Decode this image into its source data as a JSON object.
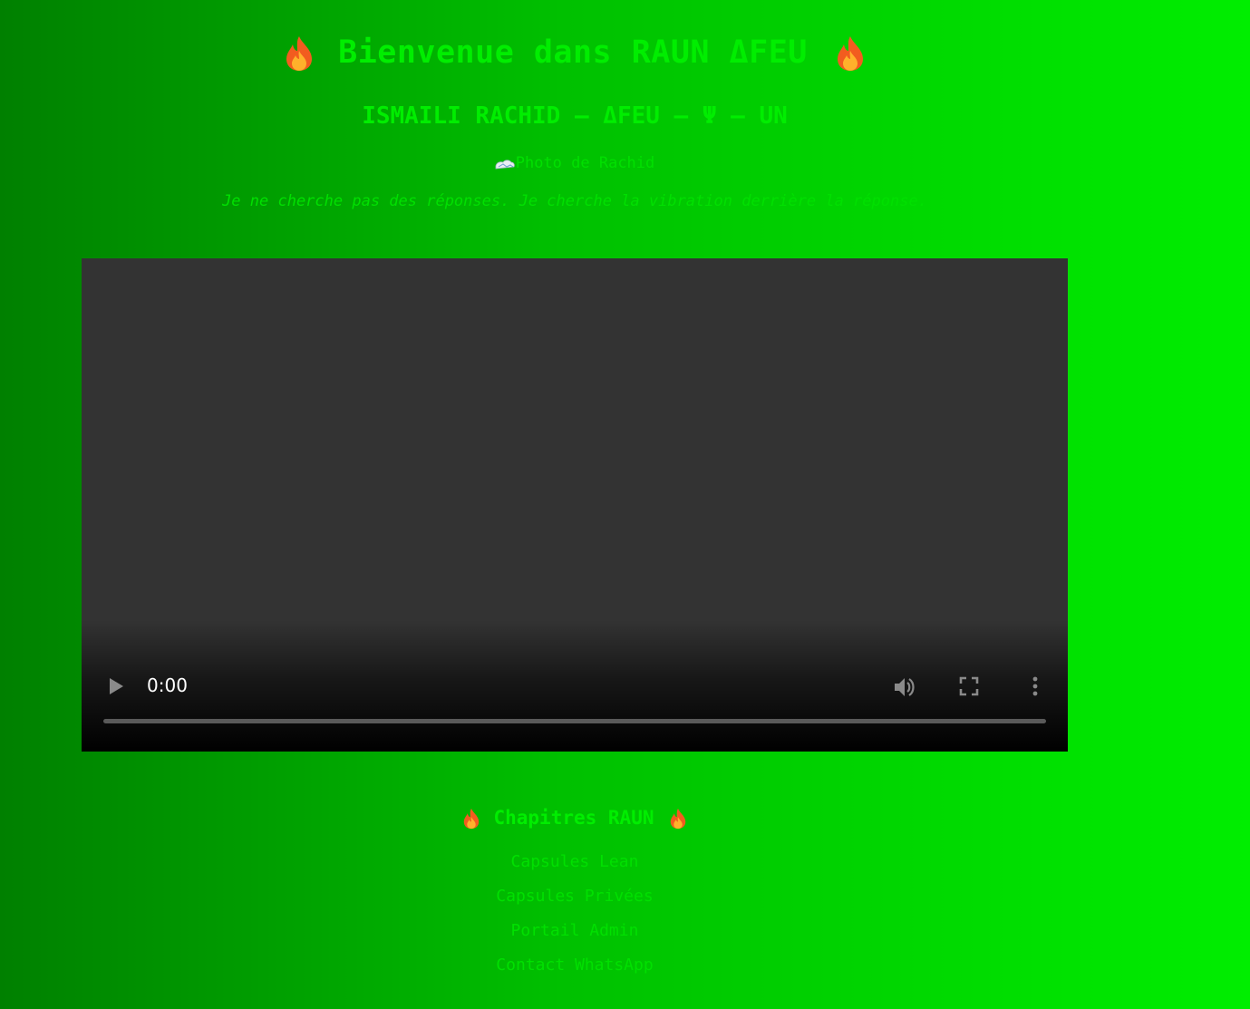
{
  "header": {
    "title": "Bienvenue dans RAUN ΔFEU",
    "subtitle": "ISMAILI RACHID – ΔFEU – Ψ – UN",
    "photo_alt": "Photo de Rachid",
    "quote": "Je ne cherche pas des réponses. Je cherche la vibration derrière la réponse."
  },
  "video": {
    "time": "0:00",
    "progress": 0
  },
  "chapters": {
    "title": "Chapitres RAUN",
    "links": [
      {
        "label": "Capsules Lean"
      },
      {
        "label": "Capsules Privées"
      },
      {
        "label": "Portail Admin"
      },
      {
        "label": "Contact WhatsApp"
      }
    ]
  },
  "icons": {
    "title_left": "fire-icon",
    "title_right": "fire-icon",
    "chapters_left": "fire-icon",
    "chapters_right": "fire-icon",
    "photo": "broken-image-icon",
    "play": "play-icon",
    "volume": "volume-icon",
    "fullscreen": "fullscreen-icon",
    "more": "more-vert-icon"
  },
  "colors": {
    "text": "#00ee00",
    "background_left": "#008000",
    "background_right": "#00ee00",
    "video_bg": "#333333"
  }
}
